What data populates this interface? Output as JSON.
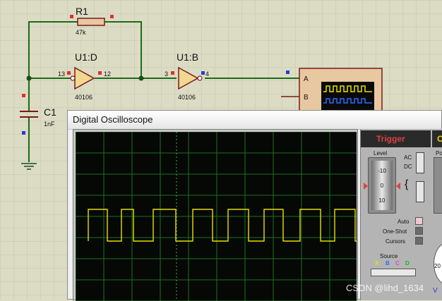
{
  "schematic": {
    "resistor": {
      "name": "R1",
      "value": "47k"
    },
    "inverter_d": {
      "name": "U1:D",
      "part": "40106",
      "pin_in": "13",
      "pin_out": "12"
    },
    "inverter_b": {
      "name": "U1:B",
      "part": "40106",
      "pin_in": "3",
      "pin_out": "4"
    },
    "capacitor": {
      "name": "C1",
      "value": "1nF"
    },
    "scope_symbol": {
      "channel_a": "A",
      "channel_b": "B"
    }
  },
  "oscilloscope": {
    "title": "Digital Oscilloscope",
    "trace_color": "#e8e000",
    "grid_color": "#1f6f1f"
  },
  "trigger_panel": {
    "title": "Trigger",
    "level_label": "Level",
    "level_ticks": [
      "-10",
      "0",
      "10"
    ],
    "ac_label": "AC",
    "dc_label": "DC",
    "auto_label": "Auto",
    "one_shot_label": "One-Shot",
    "cursors_label": "Cursors",
    "source_label": "Source",
    "source_channels": [
      "A",
      "B",
      "C",
      "D"
    ],
    "source_colors": [
      "#e8e000",
      "#2a6cff",
      "#e040e0",
      "#20b020"
    ]
  },
  "channel_panel": {
    "title_fragment": "C",
    "pos_fragment": "Po",
    "dial_tick": "20",
    "bottom_fragment": "V"
  },
  "watermark": "CSDN @lihd_1634"
}
